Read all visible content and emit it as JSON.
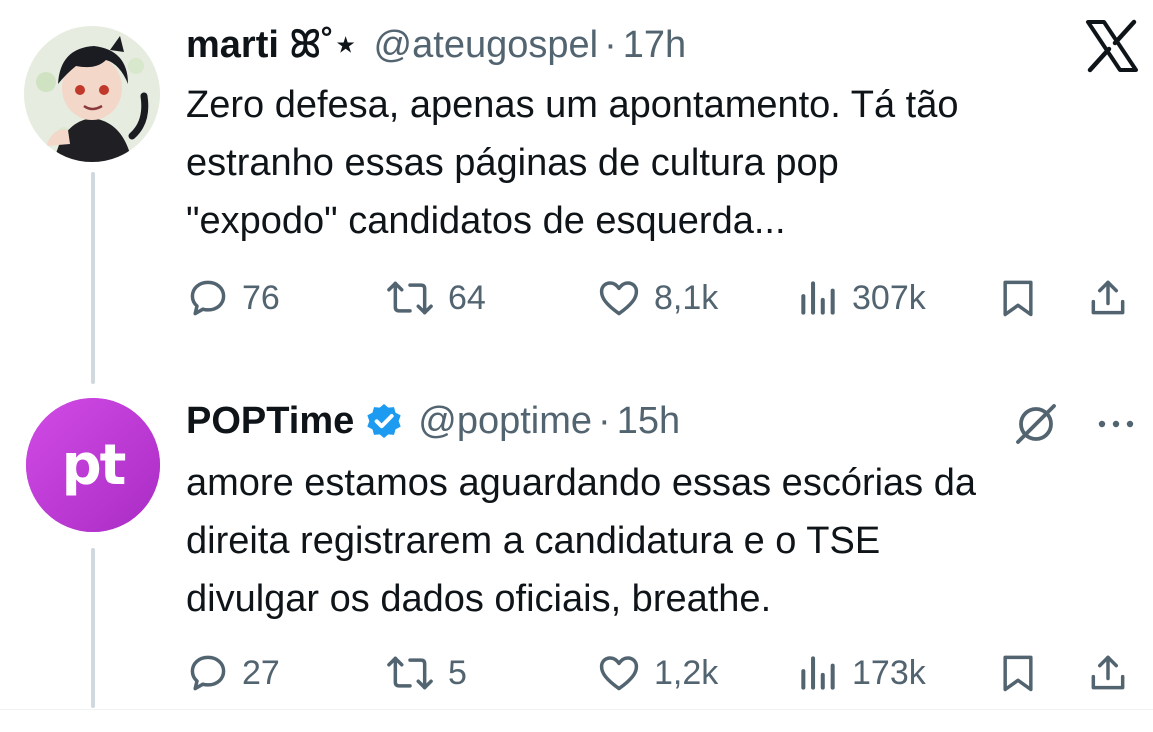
{
  "close_icon": "x-logo",
  "tweets": [
    {
      "name": "marti ꕤ˚⋆",
      "handle": "@ateugospel",
      "separator": "·",
      "time": "17h",
      "text_lines": [
        "Zero defesa, apenas um apontamento. Tá tão",
        "estranho essas páginas de cultura pop",
        "\"expodo\" candidatos de esquerda..."
      ],
      "replies": "76",
      "reposts": "64",
      "likes": "8,1k",
      "views": "307k"
    },
    {
      "name": "POPTime",
      "verified": true,
      "handle": "@poptime",
      "separator": "·",
      "time": "15h",
      "avatar_text": "pt",
      "text_lines": [
        "amore estamos aguardando essas escórias da",
        "direita registrarem a candidatura e o TSE",
        "divulgar os dados oficiais, breathe."
      ],
      "replies": "27",
      "reposts": "5",
      "likes": "1,2k",
      "views": "173k"
    }
  ],
  "colors": {
    "text": "#0f1419",
    "muted": "#536471",
    "verified": "#1d9bf0",
    "poptime_brand": "#c13ad6",
    "thread_line": "#cfd9de"
  }
}
